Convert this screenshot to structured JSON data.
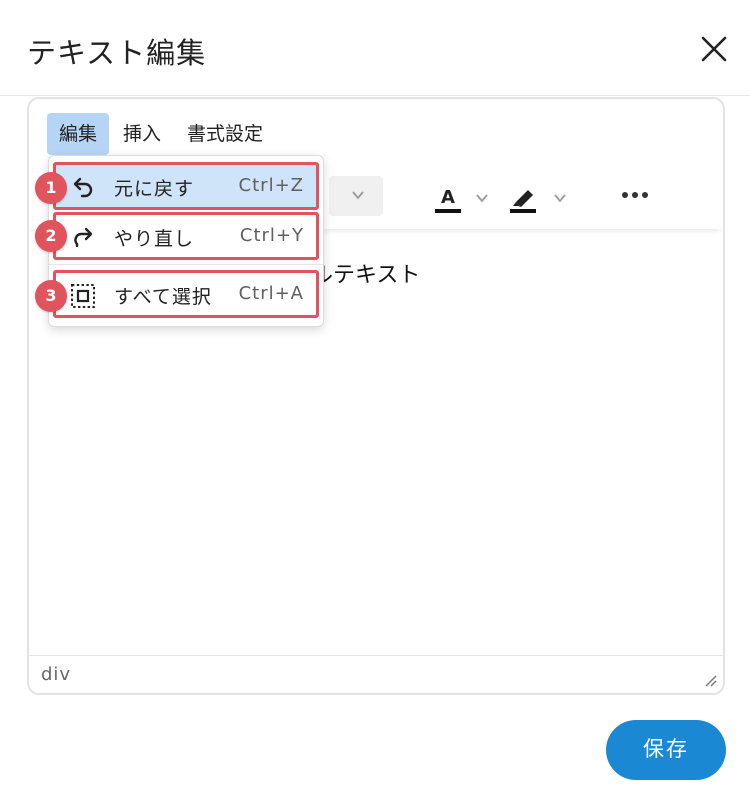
{
  "dialog": {
    "title": "テキスト編集"
  },
  "menubar": {
    "items": [
      "編集",
      "挿入",
      "書式設定"
    ]
  },
  "dropdown": {
    "items": [
      {
        "label": "元に戻す",
        "shortcut": "Ctrl+Z",
        "icon": "undo-icon",
        "badge": "1"
      },
      {
        "label": "やり直し",
        "shortcut": "Ctrl+Y",
        "icon": "redo-icon",
        "badge": "2"
      },
      {
        "label": "すべて選択",
        "shortcut": "Ctrl+A",
        "icon": "select-all-icon",
        "badge": "3"
      }
    ]
  },
  "content": {
    "text": "ルテキスト"
  },
  "statusbar": {
    "path": "div"
  },
  "footer": {
    "save_label": "保存"
  },
  "colors": {
    "accent": "#1a88d2",
    "annotation": "#e0545e",
    "menu_active": "#b6d5f6",
    "item_highlight": "#cfe3f9"
  }
}
